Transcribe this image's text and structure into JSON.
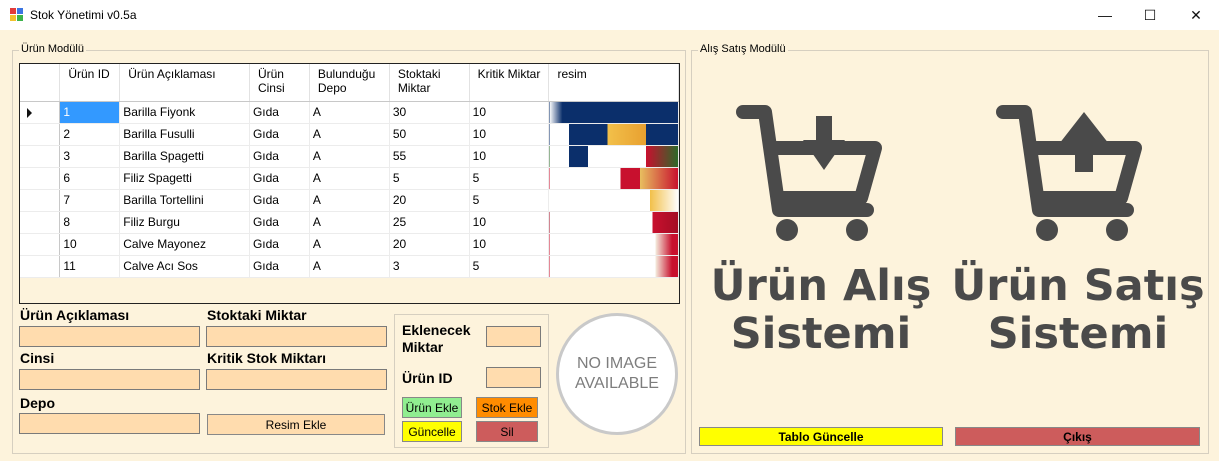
{
  "window": {
    "title": "Stok Yönetimi v0.5a",
    "minimize_glyph": "—",
    "maximize_glyph": "☐",
    "close_glyph": "✕"
  },
  "product_module": {
    "title": "Ürün Modülü",
    "columns": [
      "Ürün ID",
      "Ürün Açıklaması",
      "Ürün Cinsi",
      "Bulunduğu Depo",
      "Stoktaki Miktar",
      "Kritik Miktar",
      "resim"
    ],
    "rows": [
      {
        "id": "1",
        "desc": "Barilla Fiyonk",
        "type": "Gıda",
        "depot": "A",
        "stock": "30",
        "critical": "10"
      },
      {
        "id": "2",
        "desc": "Barilla Fusulli",
        "type": "Gıda",
        "depot": "A",
        "stock": "50",
        "critical": "10"
      },
      {
        "id": "3",
        "desc": "Barilla Spagetti",
        "type": "Gıda",
        "depot": "A",
        "stock": "55",
        "critical": "10"
      },
      {
        "id": "6",
        "desc": "Filiz Spagetti",
        "type": "Gıda",
        "depot": "A",
        "stock": "5",
        "critical": "5"
      },
      {
        "id": "7",
        "desc": "Barilla Tortellini",
        "type": "Gıda",
        "depot": "A",
        "stock": "20",
        "critical": "5"
      },
      {
        "id": "8",
        "desc": "Filiz Burgu",
        "type": "Gıda",
        "depot": "A",
        "stock": "25",
        "critical": "10"
      },
      {
        "id": "10",
        "desc": "Calve Mayonez",
        "type": "Gıda",
        "depot": "A",
        "stock": "20",
        "critical": "10"
      },
      {
        "id": "11",
        "desc": "Calve Acı Sos",
        "type": "Gıda",
        "depot": "A",
        "stock": "3",
        "critical": "5"
      }
    ],
    "form": {
      "desc_label": "Ürün Açıklaması",
      "stock_label": "Stoktaki Miktar",
      "type_label": "Cinsi",
      "critical_label": "Kritik Stok Miktarı",
      "depot_label": "Depo",
      "image_button": "Resim Ekle",
      "add_amount_label_1": "Eklenecek",
      "add_amount_label_2": "Miktar",
      "product_id_label": "Ürün ID",
      "add_product_button": "Ürün Ekle",
      "add_stock_button": "Stok Ekle",
      "update_button": "Güncelle",
      "delete_button": "Sil"
    },
    "no_image_1": "NO IMAGE",
    "no_image_2": "AVAILABLE"
  },
  "trade_module": {
    "title": "Alış Satış Modülü",
    "purchase_line1": "Ürün Alış",
    "purchase_line2": "Sistemi",
    "sale_line1": "Ürün Satış",
    "sale_line2": "Sistemi",
    "refresh_button": "Tablo Güncelle",
    "exit_button": "Çıkış"
  },
  "colors": {
    "background": "#fdf3dc",
    "input": "#ffdcae",
    "selection": "#3399ff",
    "green_button": "#90ee90",
    "orange_button": "#ff8c00",
    "yellow_button": "#ffff00",
    "red_button": "#cd5c5c",
    "icon_gray": "#4a4a4a"
  },
  "icons": [
    "cart-download-icon",
    "cart-upload-icon"
  ]
}
